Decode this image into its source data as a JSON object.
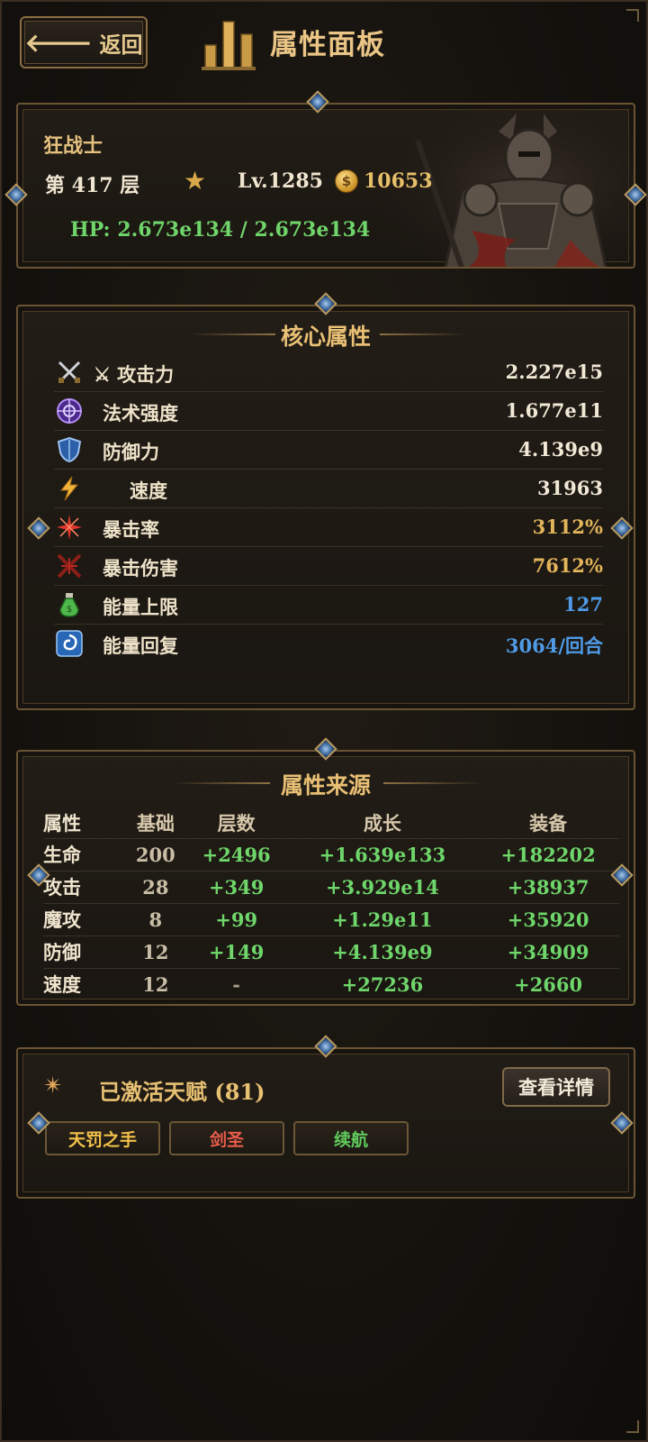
{
  "header": {
    "back_label": "返回",
    "title": "属性面板"
  },
  "character": {
    "class_name": "狂战士",
    "floor": "第 417 层",
    "level": "Lv.1285",
    "gold": "10653",
    "hp": "HP: 2.673e134 / 2.673e134"
  },
  "core": {
    "title": "核心属性",
    "rows": [
      {
        "label": "⚔ 攻击力",
        "value": "2.227e15",
        "icon": "crossed-swords-icon"
      },
      {
        "label": "法术强度",
        "value": "1.677e11",
        "icon": "magic-orb-icon"
      },
      {
        "label": "防御力",
        "value": "4.139e9",
        "icon": "shield-icon"
      },
      {
        "label": "速度",
        "value": "31963",
        "icon": "lightning-icon"
      },
      {
        "label": "暴击率",
        "value": "3112%",
        "icon": "crit-spark-icon",
        "color": "gold"
      },
      {
        "label": "暴击伤害",
        "value": "7612%",
        "icon": "crit-damage-icon",
        "color": "gold"
      },
      {
        "label": "能量上限",
        "value": "127",
        "icon": "potion-icon",
        "color": "blue"
      },
      {
        "label": "能量回复",
        "value": "3064/回合",
        "icon": "swirl-icon",
        "color": "blue"
      }
    ]
  },
  "source": {
    "title": "属性来源",
    "columns": [
      "属性",
      "基础",
      "层数",
      "成长",
      "装备"
    ],
    "rows": [
      [
        "生命",
        "200",
        "+2496",
        "+1.639e133",
        "+182202"
      ],
      [
        "攻击",
        "28",
        "+349",
        "+3.929e14",
        "+38937"
      ],
      [
        "魔攻",
        "8",
        "+99",
        "+1.29e11",
        "+35920"
      ],
      [
        "防御",
        "12",
        "+149",
        "+4.139e9",
        "+34909"
      ],
      [
        "速度",
        "12",
        "-",
        "+27236",
        "+2660"
      ]
    ]
  },
  "talents": {
    "title": "已激活天赋 (81)",
    "details_label": "查看详情",
    "tags": [
      "天罚之手",
      "剑圣",
      "续航"
    ]
  },
  "colors": {
    "gold_text": "#e8bf74",
    "green_text": "#6ed66a",
    "blue_text": "#4f9be8",
    "frame": "#6a5434"
  }
}
